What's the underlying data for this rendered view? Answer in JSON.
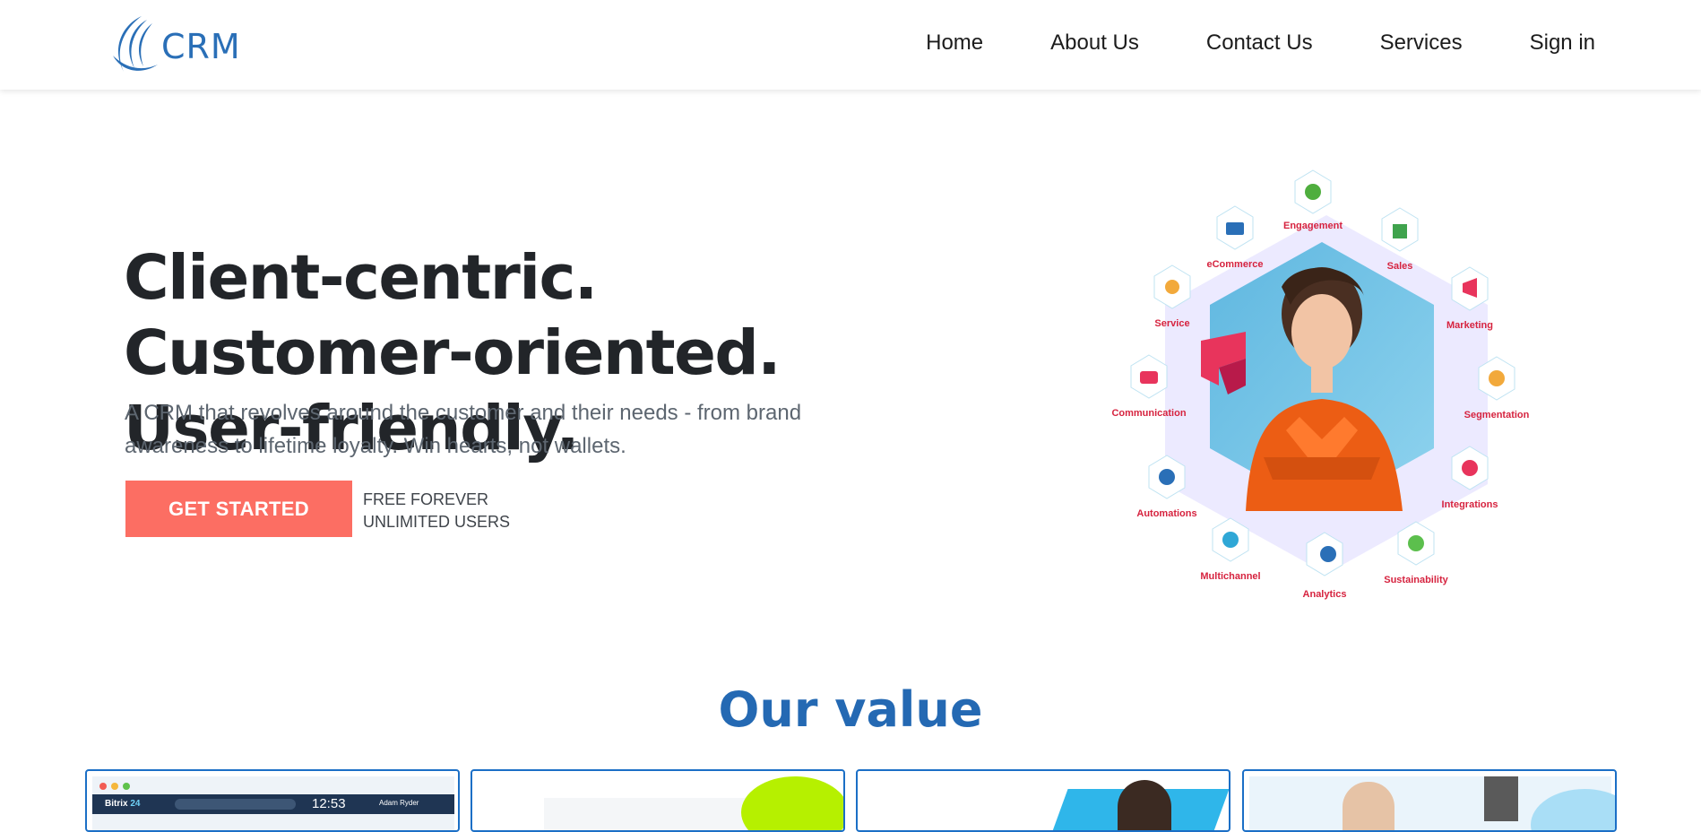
{
  "header": {
    "logo_text": "CRM",
    "nav": [
      "Home",
      "About Us",
      "Contact Us",
      "Services",
      "Sign in"
    ]
  },
  "hero": {
    "title": "Client-centric. Customer-oriented. User-friendly.",
    "subtitle": "A CRM that revolves around the customer and their needs - from brand awareness to lifetime loyalty. Win hearts, not wallets.",
    "cta_label": "GET STARTED",
    "cta_note_1": "FREE FOREVER",
    "cta_note_2": "UNLIMITED USERS"
  },
  "illustration": {
    "features": [
      "Engagement",
      "Sales",
      "Marketing",
      "Segmentation",
      "Integrations",
      "Sustainability",
      "Analytics",
      "Multichannel",
      "Automations",
      "Communication",
      "Service",
      "eCommerce"
    ]
  },
  "value_section": {
    "title": "Our value",
    "card1": {
      "brand": "Bitrix",
      "brand_num": "24",
      "clock": "12:53",
      "user": "Adam Ryder"
    }
  },
  "colors": {
    "brand_blue": "#2a6fb7",
    "cta": "#fc6e63",
    "heading_blue": "#2469b3",
    "feature_red": "#d6233f",
    "card_border": "#1b6fc6"
  }
}
